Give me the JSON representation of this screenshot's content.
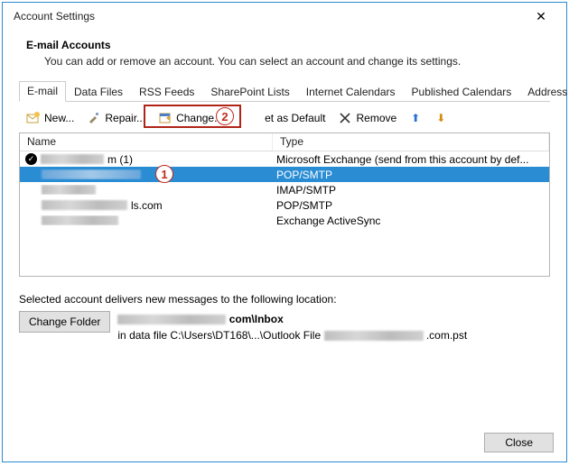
{
  "window": {
    "title": "Account Settings",
    "heading": "E-mail Accounts",
    "subheading": "You can add or remove an account. You can select an account and change its settings."
  },
  "tabs": [
    {
      "label": "E-mail",
      "active": true
    },
    {
      "label": "Data Files"
    },
    {
      "label": "RSS Feeds"
    },
    {
      "label": "SharePoint Lists"
    },
    {
      "label": "Internet Calendars"
    },
    {
      "label": "Published Calendars"
    },
    {
      "label": "Address Books"
    }
  ],
  "toolbar": {
    "new": "New...",
    "repair": "Repair...",
    "change": "Change...",
    "set_default": "et as Default",
    "remove": "Remove"
  },
  "callouts": {
    "one": "1",
    "two": "2"
  },
  "list": {
    "columns": {
      "name": "Name",
      "type": "Type"
    },
    "rows": [
      {
        "name_suffix": "m (1)",
        "type": "Microsoft Exchange (send from this account by def...",
        "default": true
      },
      {
        "name_suffix": "",
        "type": "POP/SMTP",
        "selected": true
      },
      {
        "name_suffix": "",
        "type": "IMAP/SMTP"
      },
      {
        "name_suffix": "ls.com",
        "type": "POP/SMTP"
      },
      {
        "name_suffix": "",
        "type": "Exchange ActiveSync"
      }
    ]
  },
  "delivery": {
    "label": "Selected account delivers new messages to the following location:",
    "change_folder": "Change Folder",
    "path_mid": "com\\Inbox",
    "datafile_prefix": "in data file C:\\Users\\DT168\\...\\Outlook File",
    "datafile_suffix": ".com.pst"
  },
  "footer": {
    "close": "Close"
  }
}
